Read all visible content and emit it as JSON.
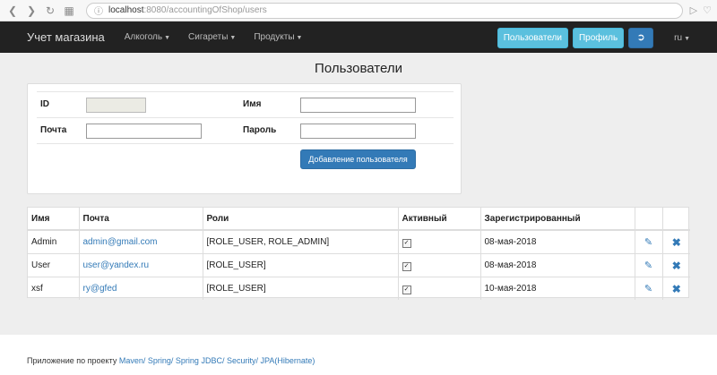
{
  "browser": {
    "url_host": "localhost",
    "url_path": ":8080/accountingOfShop/users"
  },
  "navbar": {
    "brand": "Учет магазина",
    "menus": [
      "Алкоголь",
      "Сигареты",
      "Продукты"
    ],
    "users_button": "Пользователи",
    "profile_button": "Профиль",
    "language": "ru"
  },
  "page": {
    "title": "Пользователи"
  },
  "form": {
    "id_label": "ID",
    "name_label": "Имя",
    "email_label": "Почта",
    "password_label": "Пароль",
    "add_button": "Добавление пользователя"
  },
  "table": {
    "headers": [
      "Имя",
      "Почта",
      "Роли",
      "Активный",
      "Зарегистрированный"
    ],
    "rows": [
      {
        "name": "Admin",
        "email": "admin@gmail.com",
        "roles": "[ROLE_USER, ROLE_ADMIN]",
        "active": true,
        "registered": "08-мая-2018"
      },
      {
        "name": "User",
        "email": "user@yandex.ru",
        "roles": "[ROLE_USER]",
        "active": true,
        "registered": "08-мая-2018"
      },
      {
        "name": "xsf",
        "email": "ry@gfed",
        "roles": "[ROLE_USER]",
        "active": true,
        "registered": "10-мая-2018"
      }
    ]
  },
  "footer": {
    "prefix": "Приложение по проекту",
    "links": [
      "Maven/",
      "Spring/",
      "Spring JDBC/",
      "Security/",
      "JPA(Hibernate)"
    ]
  }
}
